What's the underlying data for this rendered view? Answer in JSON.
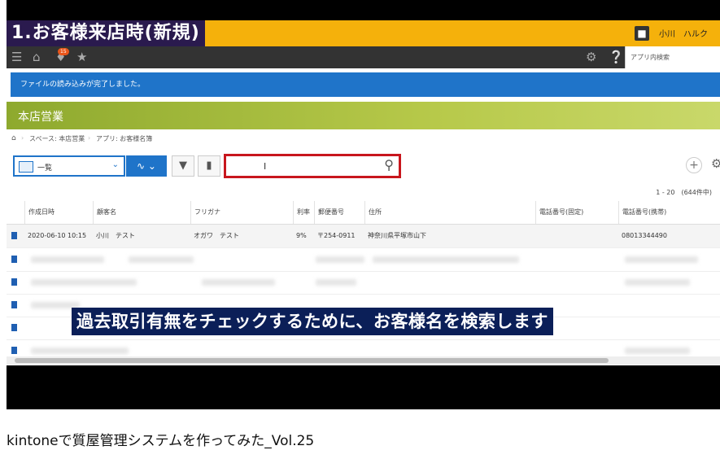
{
  "banner": {
    "title": "1.お客様来店時(新規)"
  },
  "user": {
    "name": "小川　ハルク"
  },
  "topbar": {
    "notification_count": "15",
    "app_search_placeholder": "アプリ内検索"
  },
  "notice": {
    "text": "ファイルの読み込みが完了しました。"
  },
  "space": {
    "title": "本店営業"
  },
  "breadcrumb": {
    "space": "スペース: 本店営業",
    "app": "アプリ: お客様名簿"
  },
  "toolbar": {
    "view_label": "一覧"
  },
  "pager": {
    "text": "1 - 20　(644件中)"
  },
  "table": {
    "headers": [
      "作成日時",
      "顧客名",
      "フリガナ",
      "利率",
      "郵便番号",
      "住所",
      "電話番号(固定)",
      "電話番号(携帯)"
    ],
    "row1": [
      "2020-06-10 10:15",
      "小川　テスト",
      "オガワ　テスト",
      "9%",
      "〒254-0911",
      "神奈川県平塚市山下",
      "",
      "08013344490"
    ]
  },
  "caption": {
    "text": "過去取引有無をチェックするために、お客様名を検索します"
  },
  "video": {
    "title": "kintoneで質屋管理システムを作ってみた_Vol.25"
  },
  "colors": {
    "banner": "#f5b10b",
    "notice": "#1f74c9",
    "highlight": "#c8161d",
    "space_header": "#9fb83a"
  }
}
